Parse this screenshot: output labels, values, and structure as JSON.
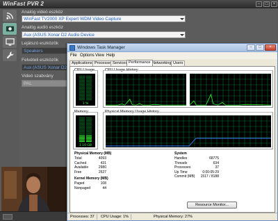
{
  "pvr": {
    "title": "WinFast PVR 2",
    "controls": {
      "minimize": "–",
      "maximize": "□",
      "close": "×"
    },
    "sidebar": [
      {
        "icon": "signal-icon"
      },
      {
        "icon": "record-icon"
      },
      {
        "icon": "monitor-icon"
      },
      {
        "icon": "wrench-icon"
      }
    ],
    "fields": [
      {
        "label": "Analóg videó eszköz",
        "value": "WinFast TV2000 XP Expert WDM Video Capture",
        "style": "light"
      },
      {
        "label": "Analóg audió eszköz",
        "value": "Aux (ASUS Xonar D2 Audio Device",
        "style": "light"
      },
      {
        "label": "Lejátszó eszközök",
        "value": "Speakers",
        "style": "dark"
      },
      {
        "label": "Felvételi eszközök",
        "value": "Aux (ASUS Xonar D2 Audio Device",
        "style": "dark"
      },
      {
        "label": "Videó szabvány",
        "value": "PAL",
        "style": "disabled"
      }
    ]
  },
  "taskmanager": {
    "title": "Windows Task Manager",
    "controls": {
      "minimize": "–",
      "maximize": "□",
      "close": "×"
    },
    "menu": [
      "File",
      "Options",
      "View",
      "Help"
    ],
    "tabs": [
      {
        "label": "Applications",
        "active": false
      },
      {
        "label": "Processes",
        "active": false
      },
      {
        "label": "Services",
        "active": false
      },
      {
        "label": "Performance",
        "active": true
      },
      {
        "label": "Networking",
        "active": false
      },
      {
        "label": "Users",
        "active": false
      }
    ],
    "cpu_usage": {
      "label": "CPU Usage",
      "percent": 1,
      "text": "1 %"
    },
    "cpu_history": {
      "label": "CPU Usage History",
      "cores": 2
    },
    "memory": {
      "label": "Memory",
      "text": "1.10 GB",
      "fill_fraction": 0.27
    },
    "memory_history": {
      "label": "Physical Memory Usage History"
    },
    "physical_memory": {
      "heading": "Physical Memory (MB)",
      "rows": [
        {
          "name": "Total",
          "value": "4093"
        },
        {
          "name": "Cached",
          "value": "431"
        },
        {
          "name": "Available",
          "value": "2980"
        },
        {
          "name": "Free",
          "value": "2527"
        }
      ]
    },
    "kernel_memory": {
      "heading": "Kernel Memory (MB)",
      "rows": [
        {
          "name": "Paged",
          "value": "108"
        },
        {
          "name": "Nonpaged",
          "value": "44"
        }
      ]
    },
    "system": {
      "heading": "System",
      "rows": [
        {
          "name": "Handles",
          "value": "68775"
        },
        {
          "name": "Threads",
          "value": "634"
        },
        {
          "name": "Processes",
          "value": "37"
        },
        {
          "name": "Up Time",
          "value": "0:00:05:29"
        },
        {
          "name": "Commit (MB)",
          "value": "1517 / 8188"
        }
      ]
    },
    "resource_monitor_label": "Resource Monitor...",
    "status": {
      "processes": "Processes: 37",
      "cpu": "CPU Usage: 1%",
      "memory": "Physical Memory: 27%"
    },
    "colors": {
      "graph_bg": "#000000",
      "grid": "#0a6b2e",
      "line": "#33ff33",
      "memory_line": "#3b7bff"
    }
  }
}
